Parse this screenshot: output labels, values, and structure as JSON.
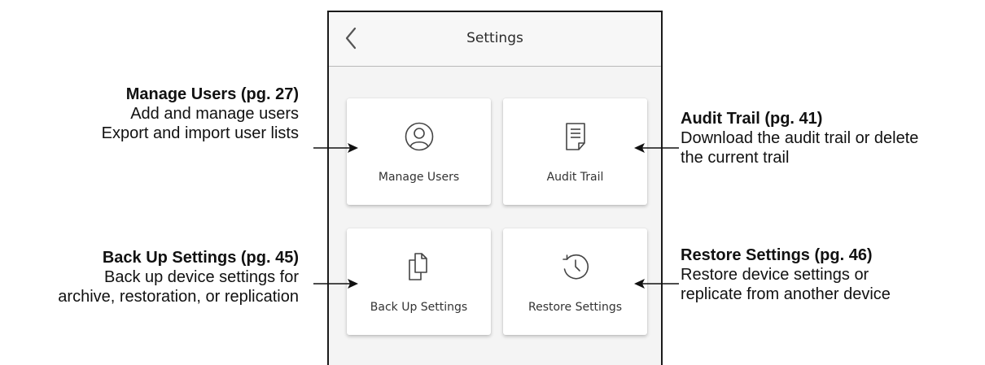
{
  "header": {
    "title": "Settings"
  },
  "tiles": [
    {
      "label": "Manage Users"
    },
    {
      "label": "Audit Trail"
    },
    {
      "label": "Back Up Settings"
    },
    {
      "label": "Restore Settings"
    }
  ],
  "annotations": {
    "manage_users": {
      "title": "Manage Users (pg.  27)",
      "lines": [
        "Add and manage users",
        "Export and import user lists"
      ]
    },
    "backup": {
      "title": "Back Up Settings (pg.  45)",
      "lines": [
        "Back up device settings for",
        "archive, restoration, or replication"
      ]
    },
    "audit_trail": {
      "title": "Audit Trail (pg.  41)",
      "lines": [
        "Download the audit trail or delete",
        "the current trail"
      ]
    },
    "restore": {
      "title": "Restore Settings (pg.  46)",
      "lines": [
        "Restore device settings or",
        "replicate from another device"
      ]
    }
  },
  "icons": [
    "chevron-left-icon",
    "user-circle-icon",
    "document-icon",
    "copy-files-icon",
    "history-clock-icon"
  ],
  "colors": {
    "background": "#ffffff",
    "screen": "#f4f4f4",
    "tile": "#ffffff",
    "text": "#333333"
  }
}
